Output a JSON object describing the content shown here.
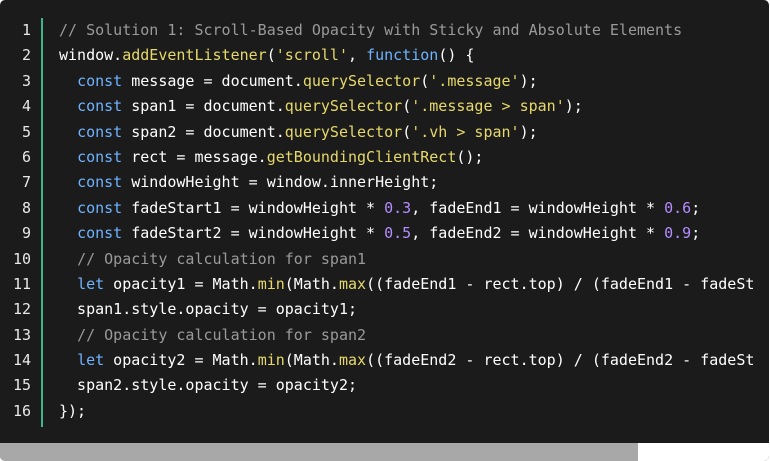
{
  "colors": {
    "background": "#1b1b1b",
    "accent_bar": "#3bb88a",
    "keyword": "#6fb3ff",
    "function": "#e6d96a",
    "string": "#e6d96a",
    "number": "#b48cff",
    "comment": "#9a9a9a",
    "plain": "#ffffff"
  },
  "scrollbar": {
    "thumb_fraction": 0.83
  },
  "lines": [
    {
      "num": "1",
      "tokens": [
        {
          "t": "// Solution 1: Scroll-Based Opacity with Sticky and Absolute Elements",
          "k": "comment"
        }
      ]
    },
    {
      "num": "2",
      "tokens": [
        {
          "t": "window.",
          "k": "plain"
        },
        {
          "t": "addEventListener",
          "k": "func"
        },
        {
          "t": "(",
          "k": "plain"
        },
        {
          "t": "'scroll'",
          "k": "string"
        },
        {
          "t": ", ",
          "k": "plain"
        },
        {
          "t": "function",
          "k": "keyword"
        },
        {
          "t": "() {",
          "k": "plain"
        }
      ]
    },
    {
      "num": "3",
      "tokens": [
        {
          "t": "  ",
          "k": "plain"
        },
        {
          "t": "const",
          "k": "keyword"
        },
        {
          "t": " message = document.",
          "k": "plain"
        },
        {
          "t": "querySelector",
          "k": "func"
        },
        {
          "t": "(",
          "k": "plain"
        },
        {
          "t": "'.message'",
          "k": "string"
        },
        {
          "t": ");",
          "k": "plain"
        }
      ]
    },
    {
      "num": "4",
      "tokens": [
        {
          "t": "  ",
          "k": "plain"
        },
        {
          "t": "const",
          "k": "keyword"
        },
        {
          "t": " span1 = document.",
          "k": "plain"
        },
        {
          "t": "querySelector",
          "k": "func"
        },
        {
          "t": "(",
          "k": "plain"
        },
        {
          "t": "'.message > span'",
          "k": "string"
        },
        {
          "t": ");",
          "k": "plain"
        }
      ]
    },
    {
      "num": "5",
      "tokens": [
        {
          "t": "  ",
          "k": "plain"
        },
        {
          "t": "const",
          "k": "keyword"
        },
        {
          "t": " span2 = document.",
          "k": "plain"
        },
        {
          "t": "querySelector",
          "k": "func"
        },
        {
          "t": "(",
          "k": "plain"
        },
        {
          "t": "'.vh > span'",
          "k": "string"
        },
        {
          "t": ");",
          "k": "plain"
        }
      ]
    },
    {
      "num": "6",
      "tokens": [
        {
          "t": "  ",
          "k": "plain"
        },
        {
          "t": "const",
          "k": "keyword"
        },
        {
          "t": " rect = message.",
          "k": "plain"
        },
        {
          "t": "getBoundingClientRect",
          "k": "func"
        },
        {
          "t": "();",
          "k": "plain"
        }
      ]
    },
    {
      "num": "7",
      "tokens": [
        {
          "t": "  ",
          "k": "plain"
        },
        {
          "t": "const",
          "k": "keyword"
        },
        {
          "t": " windowHeight = window.innerHeight;",
          "k": "plain"
        }
      ]
    },
    {
      "num": "8",
      "tokens": [
        {
          "t": "  ",
          "k": "plain"
        },
        {
          "t": "const",
          "k": "keyword"
        },
        {
          "t": " fadeStart1 = windowHeight * ",
          "k": "plain"
        },
        {
          "t": "0.3",
          "k": "number"
        },
        {
          "t": ", fadeEnd1 = windowHeight * ",
          "k": "plain"
        },
        {
          "t": "0.6",
          "k": "number"
        },
        {
          "t": ";",
          "k": "plain"
        }
      ]
    },
    {
      "num": "9",
      "tokens": [
        {
          "t": "  ",
          "k": "plain"
        },
        {
          "t": "const",
          "k": "keyword"
        },
        {
          "t": " fadeStart2 = windowHeight * ",
          "k": "plain"
        },
        {
          "t": "0.5",
          "k": "number"
        },
        {
          "t": ", fadeEnd2 = windowHeight * ",
          "k": "plain"
        },
        {
          "t": "0.9",
          "k": "number"
        },
        {
          "t": ";",
          "k": "plain"
        }
      ]
    },
    {
      "num": "10",
      "tokens": [
        {
          "t": "  ",
          "k": "plain"
        },
        {
          "t": "// Opacity calculation for span1",
          "k": "comment"
        }
      ]
    },
    {
      "num": "11",
      "tokens": [
        {
          "t": "  ",
          "k": "plain"
        },
        {
          "t": "let",
          "k": "keyword"
        },
        {
          "t": " opacity1 = Math.",
          "k": "plain"
        },
        {
          "t": "min",
          "k": "func"
        },
        {
          "t": "(Math.",
          "k": "plain"
        },
        {
          "t": "max",
          "k": "func"
        },
        {
          "t": "((fadeEnd1 - rect.top) / (fadeEnd1 - fadeSt",
          "k": "plain"
        }
      ]
    },
    {
      "num": "12",
      "tokens": [
        {
          "t": "  span1.style.opacity = opacity1;",
          "k": "plain"
        }
      ]
    },
    {
      "num": "13",
      "tokens": [
        {
          "t": "  ",
          "k": "plain"
        },
        {
          "t": "// Opacity calculation for span2",
          "k": "comment"
        }
      ]
    },
    {
      "num": "14",
      "tokens": [
        {
          "t": "  ",
          "k": "plain"
        },
        {
          "t": "let",
          "k": "keyword"
        },
        {
          "t": " opacity2 = Math.",
          "k": "plain"
        },
        {
          "t": "min",
          "k": "func"
        },
        {
          "t": "(Math.",
          "k": "plain"
        },
        {
          "t": "max",
          "k": "func"
        },
        {
          "t": "((fadeEnd2 - rect.top) / (fadeEnd2 - fadeSt",
          "k": "plain"
        }
      ]
    },
    {
      "num": "15",
      "tokens": [
        {
          "t": "  span2.style.opacity = opacity2;",
          "k": "plain"
        }
      ]
    },
    {
      "num": "16",
      "tokens": [
        {
          "t": "});",
          "k": "plain"
        }
      ]
    }
  ]
}
